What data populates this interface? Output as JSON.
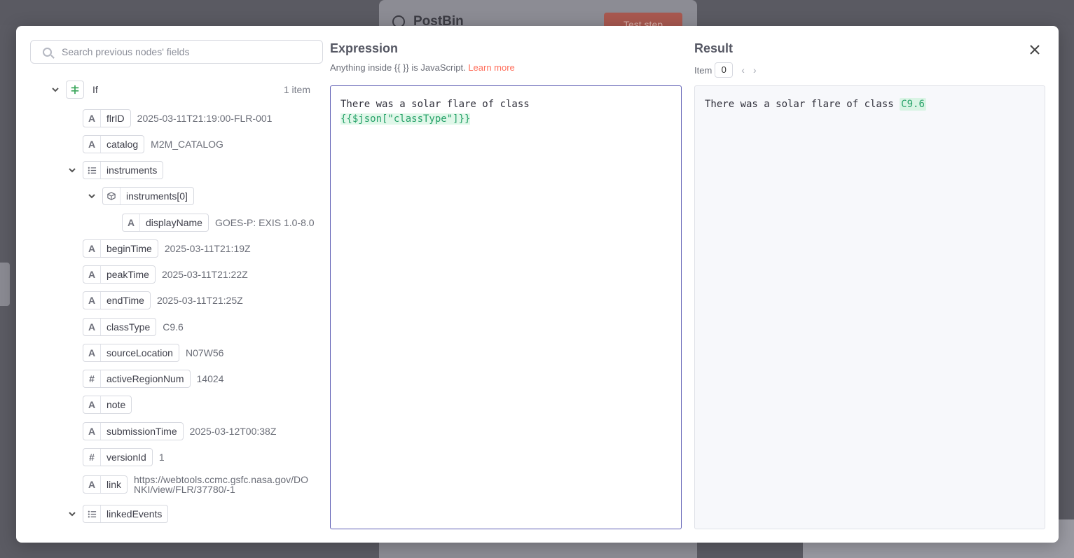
{
  "background": {
    "node_title": "PostBin",
    "test_step_label": "Test step"
  },
  "search": {
    "placeholder": "Search previous nodes' fields"
  },
  "tree": {
    "root_label": "If",
    "root_count": "1 item",
    "fields": [
      {
        "type": "A",
        "name": "flrID",
        "value": "2025-03-11T21:19:00-FLR-001"
      },
      {
        "type": "A",
        "name": "catalog",
        "value": "M2M_CATALOG"
      },
      {
        "type": "list",
        "name": "instruments",
        "value": ""
      },
      {
        "type": "obj",
        "name": "instruments[0]",
        "value": ""
      },
      {
        "type": "A",
        "name": "displayName",
        "value": "GOES-P: EXIS 1.0-8.0"
      },
      {
        "type": "A",
        "name": "beginTime",
        "value": "2025-03-11T21:19Z"
      },
      {
        "type": "A",
        "name": "peakTime",
        "value": "2025-03-11T21:22Z"
      },
      {
        "type": "A",
        "name": "endTime",
        "value": "2025-03-11T21:25Z"
      },
      {
        "type": "A",
        "name": "classType",
        "value": "C9.6"
      },
      {
        "type": "A",
        "name": "sourceLocation",
        "value": "N07W56"
      },
      {
        "type": "#",
        "name": "activeRegionNum",
        "value": "14024"
      },
      {
        "type": "A",
        "name": "note",
        "value": ""
      },
      {
        "type": "A",
        "name": "submissionTime",
        "value": "2025-03-12T00:38Z"
      },
      {
        "type": "#",
        "name": "versionId",
        "value": "1"
      },
      {
        "type": "A",
        "name": "link",
        "value": "https://webtools.ccmc.gsfc.nasa.gov/DONKI/view/FLR/37780/-1"
      },
      {
        "type": "list",
        "name": "linkedEvents",
        "value": ""
      }
    ]
  },
  "expression": {
    "title": "Expression",
    "subtitle_prefix": "Anything inside {{  }} is JavaScript.",
    "learn_more": "Learn more",
    "text_line1": "There was a solar flare of class",
    "text_line2": "{{$json[\"classType\"]}}"
  },
  "result": {
    "title": "Result",
    "item_label": "Item",
    "item_index": "0",
    "text_prefix": "There was a solar flare of class",
    "text_value": "C9.6"
  },
  "colors": {
    "accent": "#ff6d5a",
    "highlight_green": "#27a269",
    "editor_border": "#5e5eb4"
  }
}
